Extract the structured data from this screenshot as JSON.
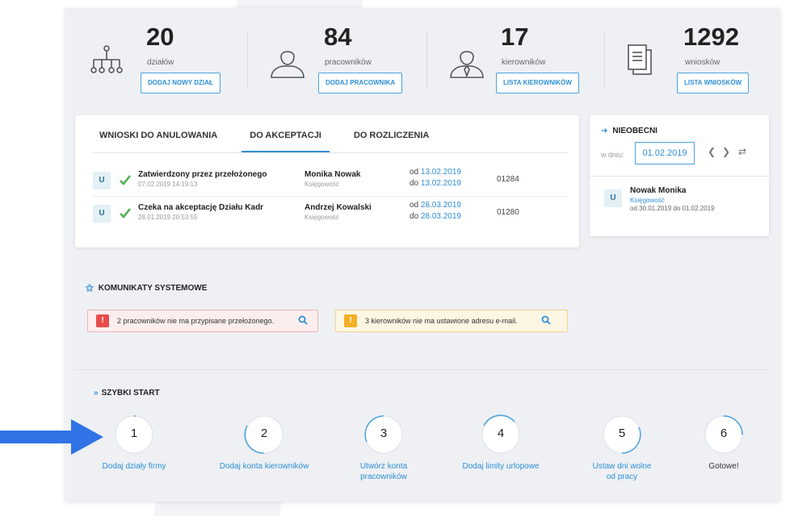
{
  "stats": [
    {
      "number": "20",
      "label": "działów",
      "button": "DODAJ NOWY DZIAŁ",
      "icon": "org-chart-icon"
    },
    {
      "number": "84",
      "label": "pracowników",
      "button": "DODAJ PRACOWNIKA",
      "icon": "employee-icon"
    },
    {
      "number": "17",
      "label": "kierowników",
      "button": "LISTA KIEROWNIKÓW",
      "icon": "manager-icon"
    },
    {
      "number": "1292",
      "label": "wniosków",
      "button": "LISTA WNIOSKÓW",
      "icon": "documents-icon"
    }
  ],
  "requests": {
    "tabs": [
      {
        "label": "WNIOSKI DO ANULOWANIA",
        "active": false
      },
      {
        "label": "DO AKCEPTACJI",
        "active": true
      },
      {
        "label": "DO ROZLICZENIA",
        "active": false
      }
    ],
    "rows": [
      {
        "avatar": "U",
        "status": "Zatwierdzony przez przełożonego",
        "datetime": "07.02.2019 14:19:13",
        "name": "Monika Nowak",
        "dept": "Księgowość",
        "from_label": "od",
        "from": "13.02.2019",
        "to_label": "do",
        "to": "13.02.2019",
        "id": "01284"
      },
      {
        "avatar": "U",
        "status": "Czeka na akceptację Działu Kadr",
        "datetime": "28.01.2019 20:53:55",
        "name": "Andrzej Kowalski",
        "dept": "Księgowość",
        "from_label": "od",
        "from": "28.03.2019",
        "to_label": "do",
        "to": "28.03.2019",
        "id": "01280"
      }
    ]
  },
  "absent": {
    "title": "NIEOBECNI",
    "date_label": "w dniu:",
    "date": "01.02.2019",
    "person": {
      "avatar": "U",
      "name": "Nowak Monika",
      "dept": "Księgowość",
      "range": "od 30.01.2019 do 01.02.2019"
    }
  },
  "system": {
    "title": "KOMUNIKATY SYSTEMOWE",
    "alerts": [
      {
        "type": "error",
        "text": "2 pracowników nie ma przypisane przełożonego."
      },
      {
        "type": "warning",
        "text": "3 kierowników nie ma ustawione adresu e-mail."
      }
    ]
  },
  "quick_start": {
    "title": "SZYBKI START",
    "steps": [
      {
        "number": "1",
        "label": "Dodaj działy firmy"
      },
      {
        "number": "2",
        "label": "Dodaj konta kierowników"
      },
      {
        "number": "3",
        "label": "Utwórz konta pracowników"
      },
      {
        "number": "4",
        "label": "Dodaj limity urlopowe"
      },
      {
        "number": "5",
        "label": "Ustaw dni wolne od pracy"
      },
      {
        "number": "6",
        "label": "Gotowe!"
      }
    ]
  },
  "colors": {
    "accent": "#2f8fd6",
    "arrow": "#2f73e6",
    "error": "#e84c4c",
    "warning": "#f2b025",
    "check": "#4caf50"
  }
}
